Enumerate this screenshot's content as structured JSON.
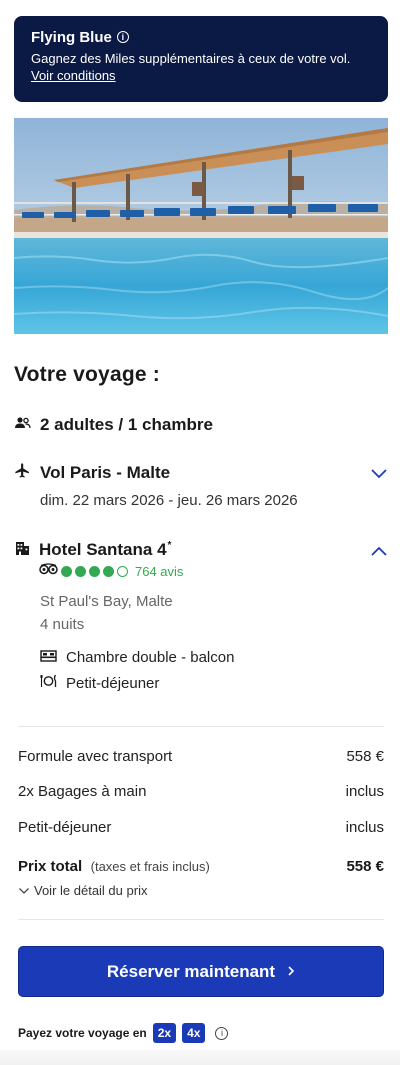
{
  "banner": {
    "title": "Flying Blue",
    "text": "Gagnez des Miles supplémentaires à ceux de votre vol.",
    "link": "Voir conditions"
  },
  "trip": {
    "title": "Votre voyage :",
    "travellers": "2 adultes / 1 chambre",
    "flight": {
      "title": "Vol Paris - Malte",
      "dates": "dim. 22 mars 2026 - jeu. 26 mars 2026",
      "icon": "airplane-icon"
    },
    "hotel": {
      "name": "Hotel Santana 4",
      "star_mark": "*",
      "rating": 4,
      "rating_max": 5,
      "reviews": "764 avis",
      "location": "St Paul's Bay, Malte",
      "nights": "4 nuits",
      "room": "Chambre double - balcon",
      "board": "Petit-déjeuner"
    }
  },
  "prices": {
    "rows": [
      {
        "label": "Formule avec transport",
        "value": "558 €"
      },
      {
        "label": "2x Bagages à main",
        "value": "inclus"
      },
      {
        "label": "Petit-déjeuner",
        "value": "inclus"
      }
    ],
    "total_label": "Prix total",
    "total_sub": "(taxes et frais inclus)",
    "total_value": "558 €",
    "detail_link": "Voir le détail du prix"
  },
  "cta": {
    "label": "Réserver maintenant"
  },
  "payment": {
    "label": "Payez votre voyage en",
    "options": [
      "2x",
      "4x"
    ]
  },
  "colors": {
    "banner_bg": "#0b1a45",
    "primary": "#1b3ab8",
    "rating_green": "#34a853",
    "chevron": "#1b3ab8"
  }
}
